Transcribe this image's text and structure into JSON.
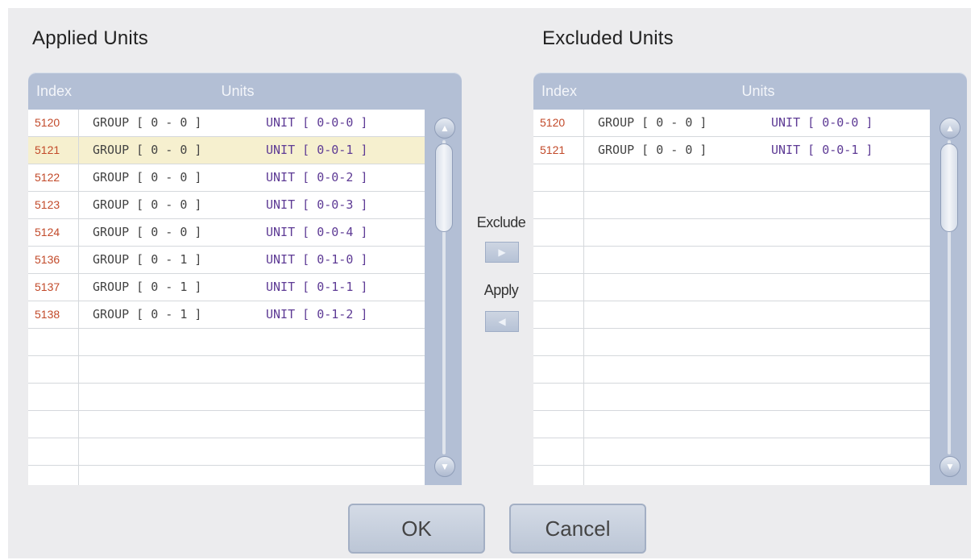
{
  "applied": {
    "title": "Applied Units",
    "header_index": "Index",
    "header_units": "Units",
    "rows": [
      {
        "index": "5120",
        "group": "GROUP [ 0 - 0 ]",
        "unit": "UNIT [ 0-0-0 ]"
      },
      {
        "index": "5121",
        "group": "GROUP [ 0 - 0 ]",
        "unit": "UNIT [ 0-0-1 ]"
      },
      {
        "index": "5122",
        "group": "GROUP [ 0 - 0 ]",
        "unit": "UNIT [ 0-0-2 ]"
      },
      {
        "index": "5123",
        "group": "GROUP [ 0 - 0 ]",
        "unit": "UNIT [ 0-0-3 ]"
      },
      {
        "index": "5124",
        "group": "GROUP [ 0 - 0 ]",
        "unit": "UNIT [ 0-0-4 ]"
      },
      {
        "index": "5136",
        "group": "GROUP [ 0 - 1 ]",
        "unit": "UNIT [ 0-1-0 ]"
      },
      {
        "index": "5137",
        "group": "GROUP [ 0 - 1 ]",
        "unit": "UNIT [ 0-1-1 ]"
      },
      {
        "index": "5138",
        "group": "GROUP [ 0 - 1 ]",
        "unit": "UNIT [ 0-1-2 ]"
      }
    ],
    "selected_index": "5121"
  },
  "excluded": {
    "title": "Excluded Units",
    "header_index": "Index",
    "header_units": "Units",
    "rows": [
      {
        "index": "5120",
        "group": "GROUP [ 0 - 0 ]",
        "unit": "UNIT [ 0-0-0 ]"
      },
      {
        "index": "5121",
        "group": "GROUP [ 0 - 0 ]",
        "unit": "UNIT [ 0-0-1 ]"
      }
    ]
  },
  "middle": {
    "exclude_label": "Exclude",
    "apply_label": "Apply",
    "exclude_icon": "triangle-right",
    "apply_icon": "triangle-left"
  },
  "footer": {
    "ok_label": "OK",
    "cancel_label": "Cancel"
  },
  "colors": {
    "panel": "#b3bfd5",
    "index_text": "#c24a2a",
    "unit_text": "#5e3b95",
    "selected_row": "#f6f0cf"
  }
}
